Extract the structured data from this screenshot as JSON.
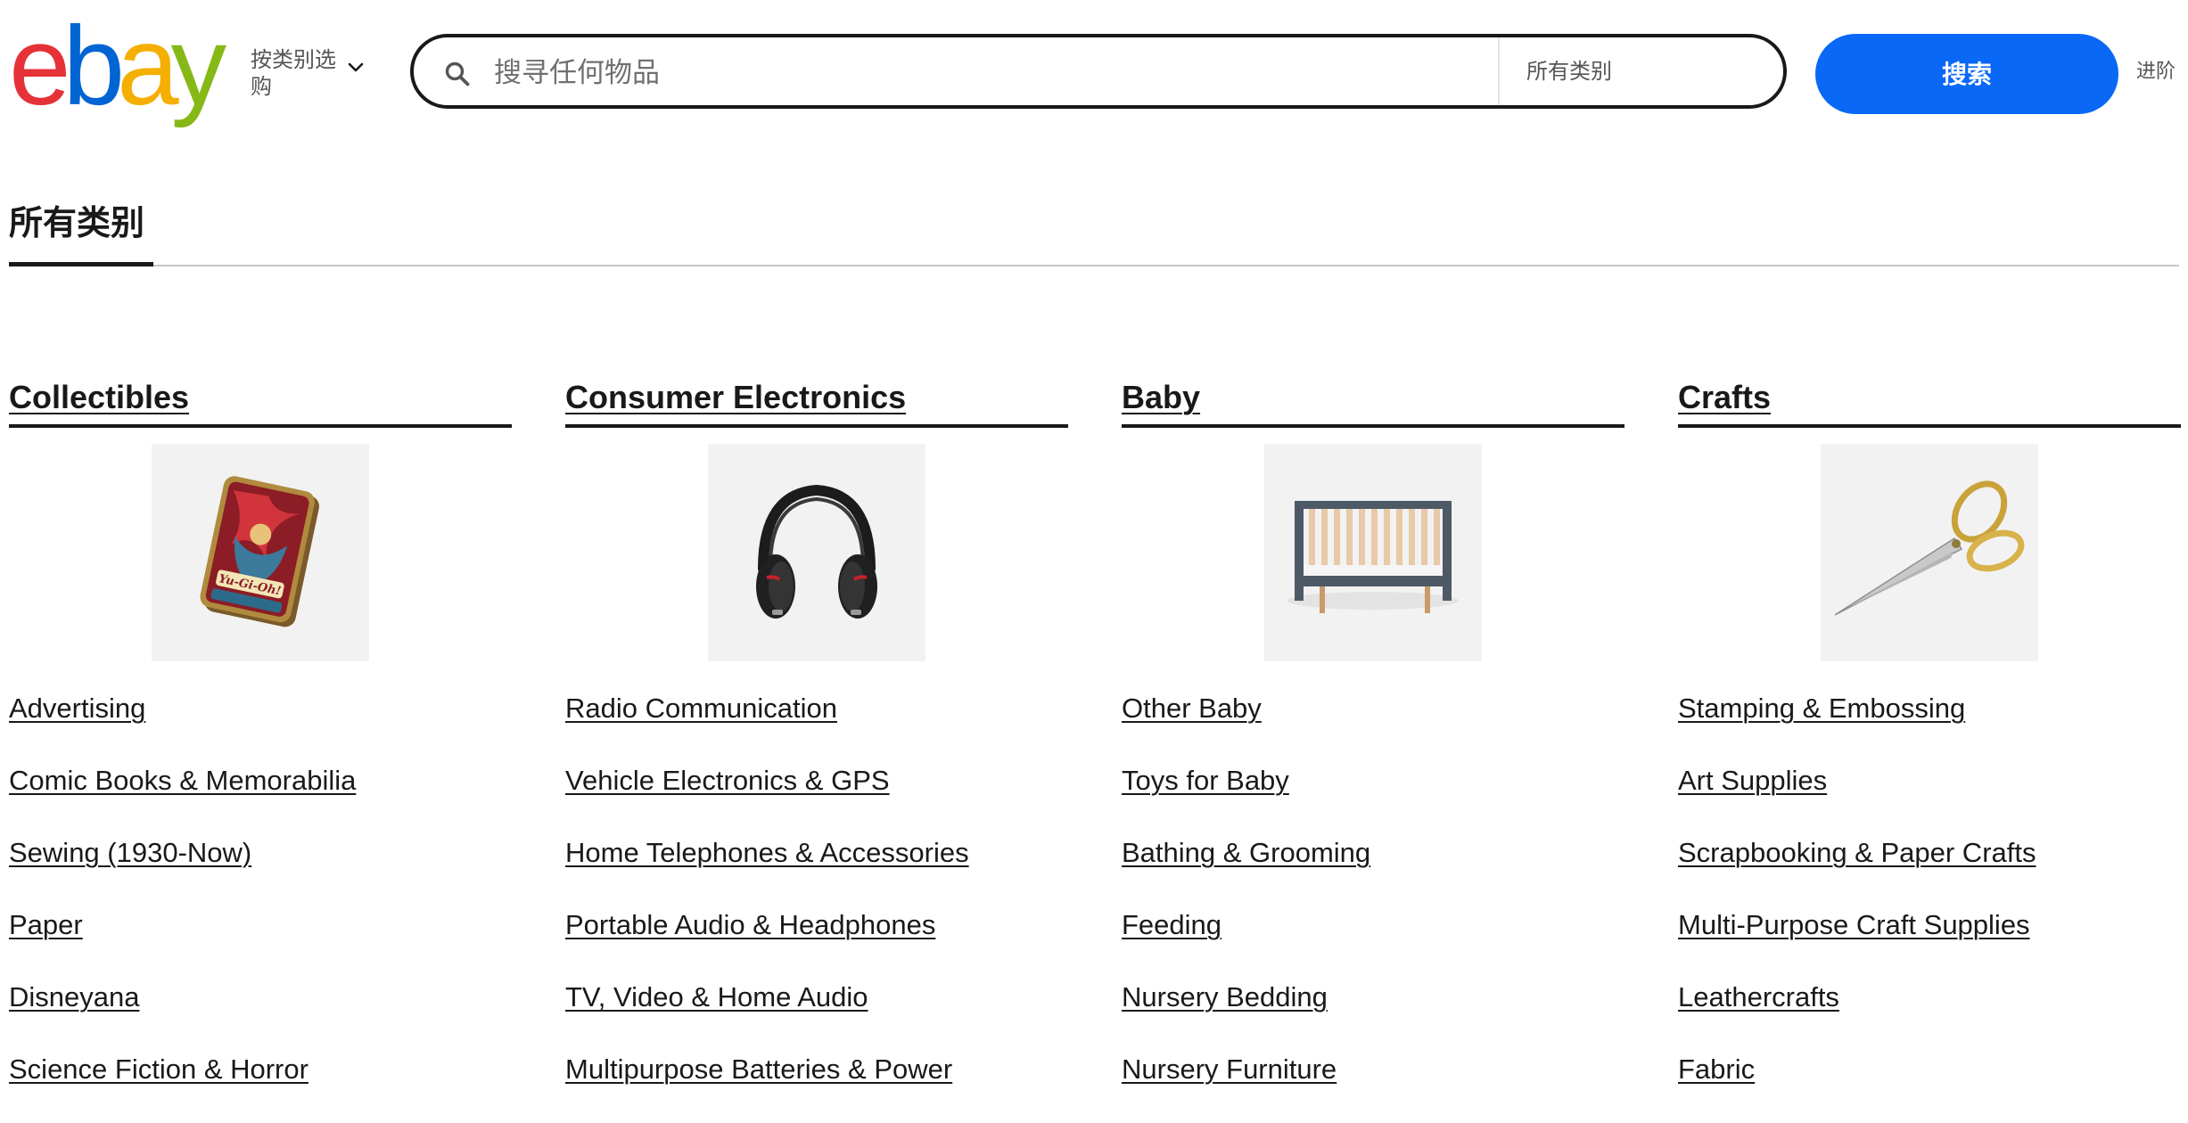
{
  "header": {
    "logo": {
      "letters": [
        "e",
        "b",
        "a",
        "y"
      ],
      "colors": [
        "#e53238",
        "#0064d2",
        "#f5af02",
        "#86b817"
      ]
    },
    "shop_by_category": "按类别选购",
    "shop_by_icon": "chevron-down-icon",
    "search": {
      "icon": "search-icon",
      "placeholder": "搜寻任何物品",
      "value": "",
      "category": "所有类别",
      "button_label": "搜索",
      "button_color": "#0968f6"
    },
    "advanced_label": "进阶"
  },
  "page": {
    "title": "所有类别"
  },
  "columns": [
    {
      "heading": "Collectibles",
      "image_icon": "trading-card-tin-icon",
      "links": [
        "Advertising",
        "Comic Books & Memorabilia",
        "Sewing (1930-Now)",
        "Paper",
        "Disneyana",
        "Science Fiction & Horror"
      ]
    },
    {
      "heading": "Consumer Electronics",
      "image_icon": "headphones-icon",
      "links": [
        "Radio Communication",
        "Vehicle Electronics & GPS",
        "Home Telephones & Accessories",
        "Portable Audio & Headphones",
        "TV, Video & Home Audio",
        "Multipurpose Batteries & Power"
      ]
    },
    {
      "heading": "Baby",
      "image_icon": "crib-icon",
      "links": [
        "Other Baby",
        "Toys for Baby",
        "Bathing & Grooming",
        "Feeding",
        "Nursery Bedding",
        "Nursery Furniture"
      ]
    },
    {
      "heading": "Crafts",
      "image_icon": "scissors-icon",
      "links": [
        "Stamping & Embossing",
        "Art Supplies",
        "Scrapbooking & Paper Crafts",
        "Multi-Purpose Craft Supplies",
        "Leathercrafts",
        "Fabric"
      ]
    }
  ]
}
